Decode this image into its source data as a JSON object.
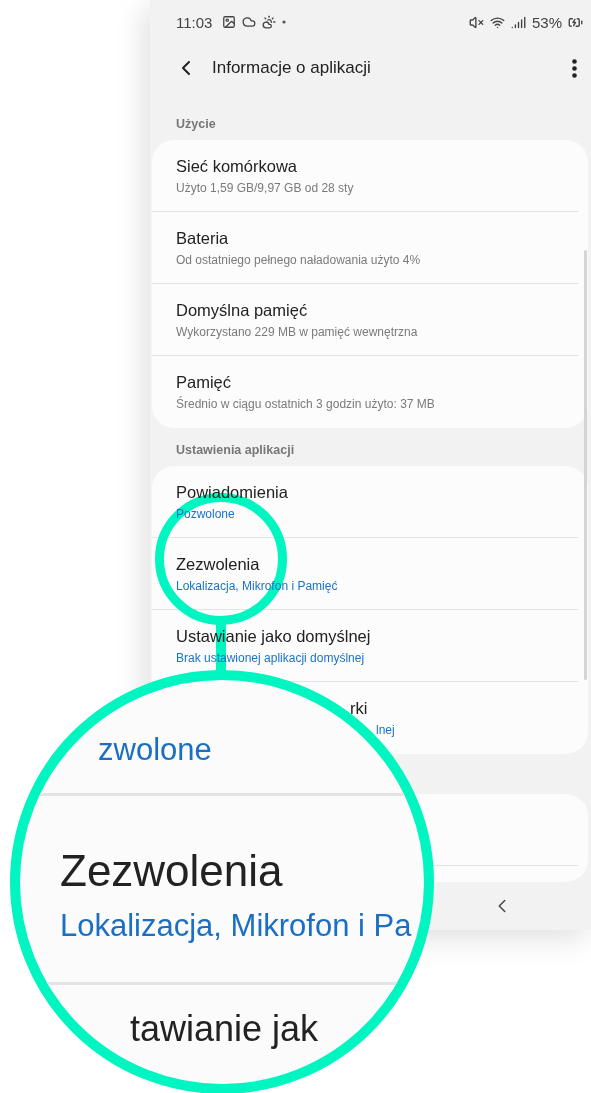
{
  "status_bar": {
    "time": "11:03",
    "battery": "53%"
  },
  "header": {
    "title": "Informacje o aplikacji"
  },
  "sections": [
    {
      "label": "Użycie",
      "rows": [
        {
          "kind": "info",
          "title": "Sieć komórkowa",
          "subtitle": "Użyto 1,59 GB/9,97 GB od 28 sty"
        },
        {
          "kind": "info",
          "title": "Bateria",
          "subtitle": "Od ostatniego pełnego naładowania użyto 4%"
        },
        {
          "kind": "info",
          "title": "Domyślna pamięć",
          "subtitle": "Wykorzystano 229 MB w pamięć wewnętrzna"
        },
        {
          "kind": "info",
          "title": "Pamięć",
          "subtitle": "Średnio w ciągu ostatnich 3 godzin użyto: 37 MB"
        }
      ]
    },
    {
      "label": "Ustawienia aplikacji",
      "rows": [
        {
          "kind": "setting",
          "title": "Powiadomienia",
          "subtitle": "Pozwolone"
        },
        {
          "kind": "setting",
          "title": "Zezwolenia",
          "subtitle": "Lokalizacja, Mikrofon i Pamięć"
        },
        {
          "kind": "setting",
          "title": "Ustawianie jako domyślnej",
          "subtitle": "Brak ustawionej aplikacji domyślnej"
        },
        {
          "kind": "covered",
          "title": "rki",
          "subtitle": "lnej"
        }
      ]
    }
  ],
  "magnifier": {
    "lines": [
      {
        "kind": "subtitle",
        "text": "zwolone"
      },
      {
        "kind": "title",
        "text": "Zezwolenia"
      },
      {
        "kind": "subtitle",
        "text": "Lokalizacja, Mikrofon i Pa"
      },
      {
        "kind": "title",
        "text": "tawianie jak"
      }
    ]
  }
}
